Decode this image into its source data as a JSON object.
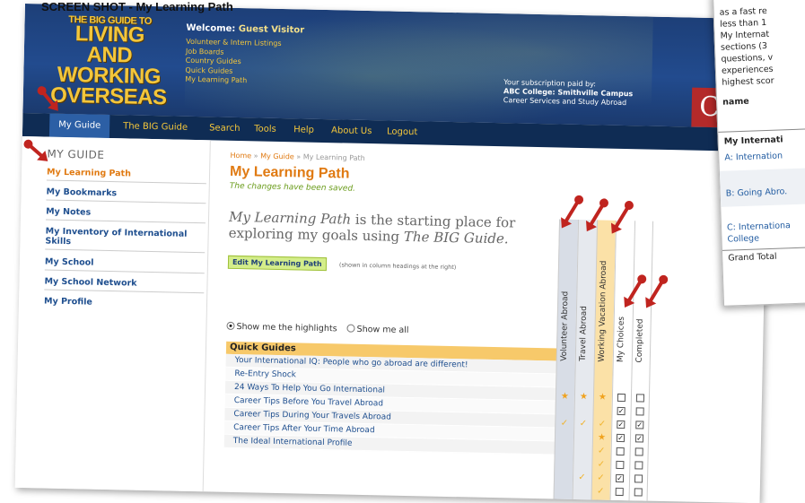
{
  "caption": "SCREEN SHOT - My Learning Path",
  "banner": {
    "logo_line1": "THE BIG GUIDE TO",
    "logo_line2": "LIVING AND",
    "logo_line3": "WORKING",
    "logo_line4": "OVERSEAS",
    "welcome_prefix": "Welcome:",
    "welcome_user": "Guest Visitor",
    "links": [
      "Volunteer & Intern Listings",
      "Job Boards",
      "Country Guides",
      "Quick Guides",
      "My Learning Path"
    ],
    "subscription_line1": "Your subscription paid by:",
    "subscription_line2": "ABC College: Smithville Campus",
    "subscription_line3": "Career Services and Study Abroad",
    "red_badge": "C"
  },
  "nav": {
    "tabs": [
      "My Guide",
      "The BIG Guide",
      "Search",
      "Tools",
      "Help",
      "About Us",
      "Logout"
    ],
    "active": "My Guide"
  },
  "sidebar": {
    "heading": "MY GUIDE",
    "items": [
      "My Learning Path",
      "My Bookmarks",
      "My Notes",
      "My Inventory of International Skills",
      "My School",
      "My School Network",
      "My Profile"
    ]
  },
  "content": {
    "breadcrumb": [
      "Home",
      "My Guide",
      "My Learning Path"
    ],
    "breadcrumb_sep": "»",
    "title": "My Learning Path",
    "saved_msg": "The changes have been saved.",
    "intro_italic1": "My Learning Path",
    "intro_mid": " is the starting place for exploring my goals using ",
    "intro_italic2": "The BIG Guide.",
    "edit_button": "Edit My Learning Path",
    "edit_note": "(shown in column headings at the right)",
    "radio_highlights": "Show me the highlights",
    "radio_all": "Show me all",
    "table_heading": "Quick Guides",
    "rows": [
      "Your International IQ: People who go abroad are different!",
      "Re-Entry Shock",
      "24 Ways To Help You Go International",
      "Career Tips Before You Travel Abroad",
      "Career Tips During Your Travels Abroad",
      "Career Tips After Your Time Abroad",
      "The Ideal International Profile"
    ]
  },
  "columns": [
    "Volunteer Abroad",
    "Travel Abroad",
    "Working Vacation Abroad",
    "My Choices",
    "Completed"
  ],
  "inset": {
    "lines": [
      "as a fast re",
      "less than 1",
      "My Internat",
      "sections (3",
      "questions, v",
      "experiences",
      "highest scor"
    ],
    "name_label": "name",
    "table_header": "My Internati",
    "row_a": "A: Internation",
    "row_b": "B: Going Abro.",
    "row_c1": "C: Internationa",
    "row_c2": "College",
    "grand_total": "Grand Total"
  }
}
